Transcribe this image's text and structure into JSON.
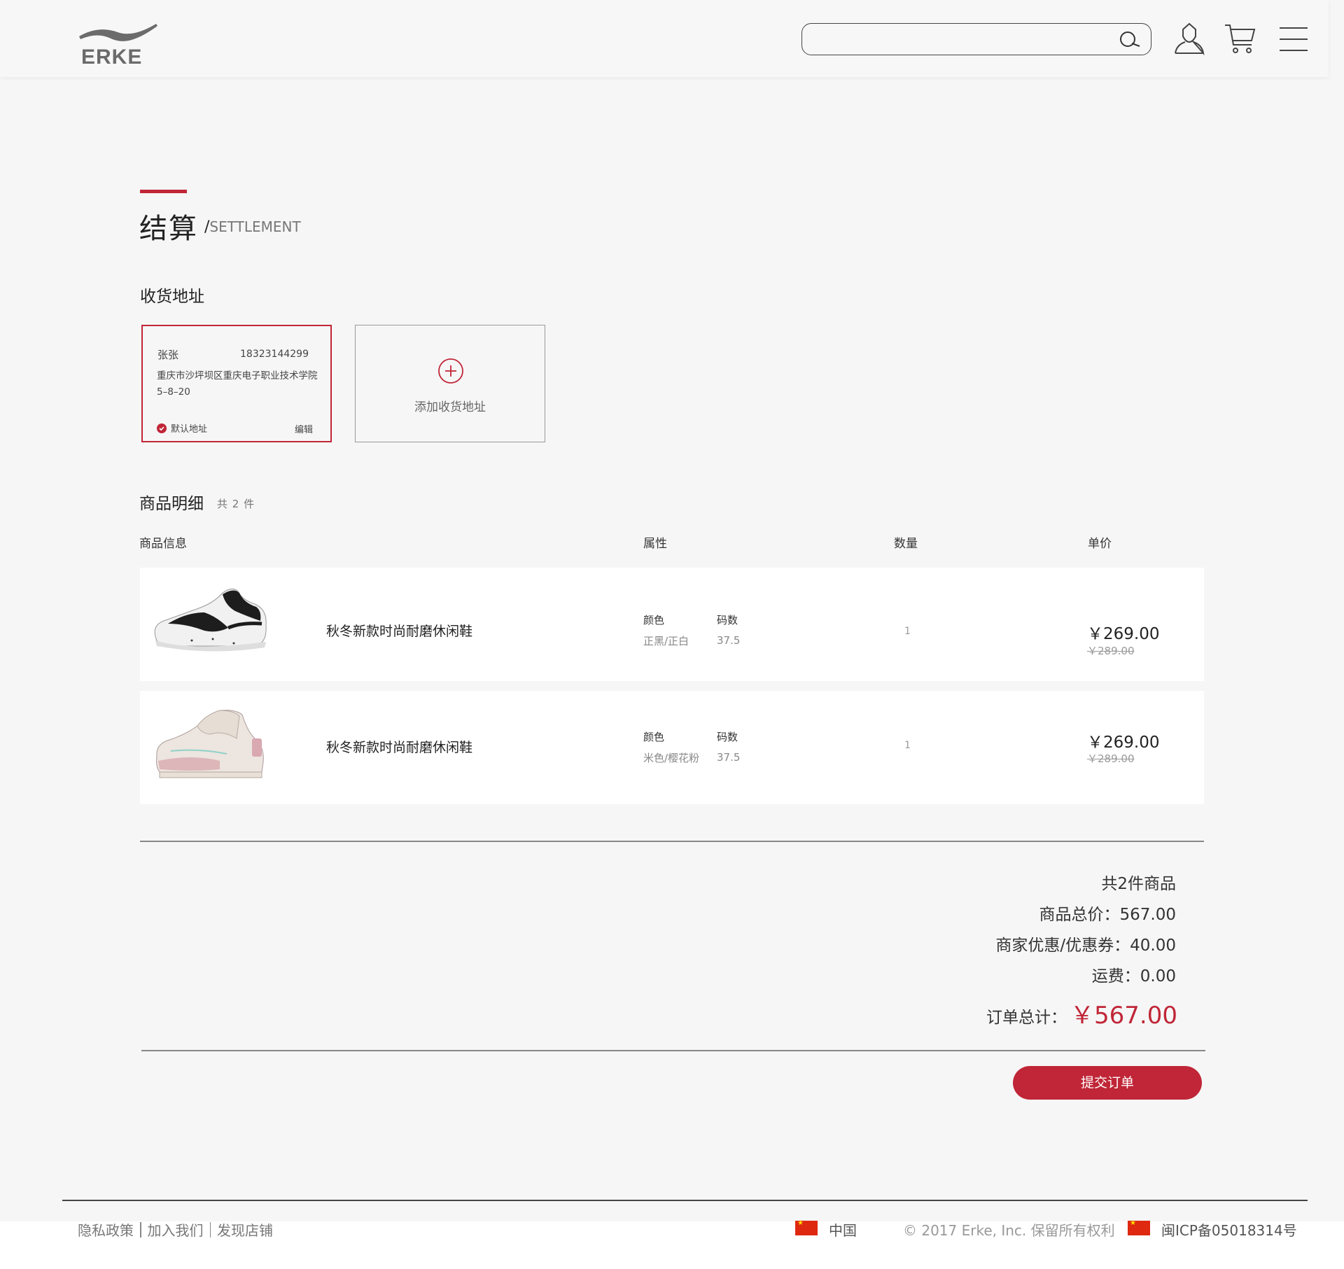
{
  "header": {
    "logo_text": "ERKE",
    "search": {
      "value": "",
      "placeholder": ""
    }
  },
  "page": {
    "title": "结算",
    "subtitle_slash": "/",
    "subtitle": "SETTLEMENT"
  },
  "address": {
    "section_label": "收货地址",
    "card": {
      "name": "张张",
      "phone": "18323144299",
      "text": "重庆市沙坪坝区重庆电子职业技术学院5–8–20",
      "default_label": "默认地址",
      "edit_label": "编辑"
    },
    "add_label": "添加收货地址"
  },
  "items_section": {
    "label": "商品明细",
    "count_note": "共 2 件",
    "columns": [
      "商品信息",
      "属性",
      "数量",
      "单价"
    ],
    "items": [
      {
        "name": "秋冬新款时尚耐磨休闲鞋",
        "color_label": "颜色",
        "color_value": "正黑/正白",
        "size_label": "码数",
        "size_value": "37.5",
        "quantity": "1",
        "price": "￥269.00",
        "old_price": "￥289.00"
      },
      {
        "name": "秋冬新款时尚耐磨休闲鞋",
        "color_label": "颜色",
        "color_value": "米色/樱花粉",
        "size_label": "码数",
        "size_value": "37.5",
        "quantity": "1",
        "price": "￥269.00",
        "old_price": "￥289.00"
      }
    ]
  },
  "summary": {
    "count_text": "共2件商品",
    "subtotal": "商品总价：567.00",
    "discount": "商家优惠/优惠券：40.00",
    "shipping": "运费：0.00",
    "total_label": "订单总计：",
    "total_value": "￥567.00",
    "submit_label": "提交订单"
  },
  "footer": {
    "links": [
      "隐私政策",
      "加入我们",
      "发现店铺"
    ],
    "region": "中国",
    "copyright": "© 2017 Erke, Inc. 保留所有权利",
    "icp": "闽ICP备05018314号"
  },
  "colors": {
    "accent": "#c02637",
    "background": "#f6f6f6"
  }
}
